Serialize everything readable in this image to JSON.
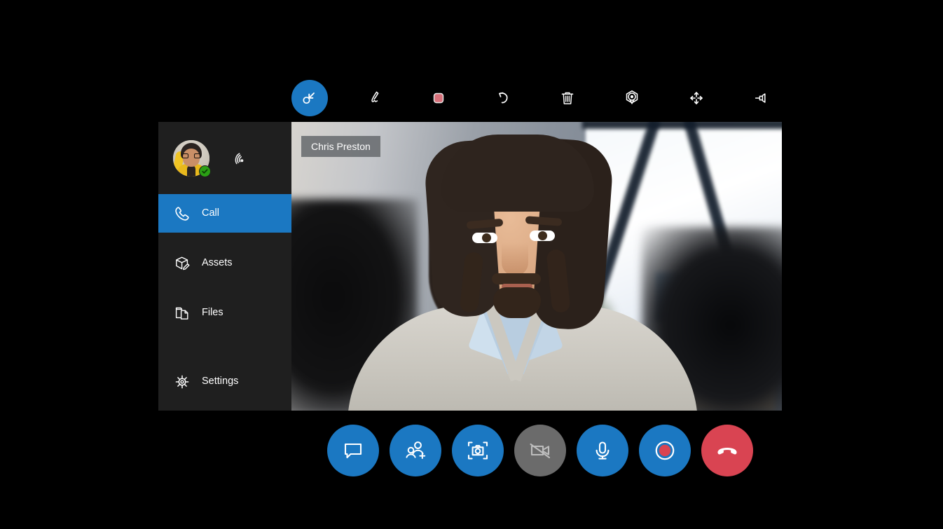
{
  "app": {
    "background_color": "#000000",
    "accent_color": "#1b78c2",
    "sidebar_color": "#1f1f1f",
    "danger_color": "#d94452",
    "online_color": "#2aa014"
  },
  "toolbar": {
    "items": [
      {
        "name": "select-tool",
        "label": "Select",
        "icon": "cursor-select-icon",
        "active": true
      },
      {
        "name": "ink-tool",
        "label": "Ink",
        "icon": "pen-icon",
        "active": false
      },
      {
        "name": "color-swatch",
        "label": "Color",
        "icon": "color-swatch-icon",
        "active": false,
        "color": "#d7707a"
      },
      {
        "name": "undo-tool",
        "label": "Undo",
        "icon": "undo-arrow-icon",
        "active": false
      },
      {
        "name": "delete-tool",
        "label": "Delete",
        "icon": "trash-icon",
        "active": false
      },
      {
        "name": "anchor-tool",
        "label": "Anchor",
        "icon": "location-anchor-icon",
        "active": false
      },
      {
        "name": "move-tool",
        "label": "Move",
        "icon": "move-arrows-icon",
        "active": false
      },
      {
        "name": "pin-tool",
        "label": "Pin",
        "icon": "pushpin-icon",
        "active": false
      }
    ]
  },
  "sidebar": {
    "user": {
      "avatar_alt": "User avatar",
      "presence": "available",
      "presence_icon": "check-badge-icon",
      "signal_icon": "signal-strength-icon"
    },
    "items": [
      {
        "label": "Call",
        "icon": "phone-icon",
        "active": true
      },
      {
        "label": "Assets",
        "icon": "assets-box-icon",
        "active": false
      },
      {
        "label": "Files",
        "icon": "files-folder-icon",
        "active": false
      },
      {
        "label": "Settings",
        "icon": "gear-icon",
        "active": false
      }
    ]
  },
  "video": {
    "participant_name": "Chris Preston"
  },
  "callbar": {
    "buttons": [
      {
        "name": "chat-button",
        "label": "Chat",
        "icon": "chat-bubble-icon",
        "style": "blue"
      },
      {
        "name": "add-participant-button",
        "label": "Add participant",
        "icon": "add-person-icon",
        "style": "blue"
      },
      {
        "name": "snapshot-button",
        "label": "Snapshot",
        "icon": "camera-capture-icon",
        "style": "blue"
      },
      {
        "name": "video-toggle-button",
        "label": "Video off",
        "icon": "video-off-icon",
        "style": "gray"
      },
      {
        "name": "mic-button",
        "label": "Microphone",
        "icon": "microphone-icon",
        "style": "blue"
      },
      {
        "name": "record-button",
        "label": "Record",
        "icon": "record-dot-icon",
        "style": "blue"
      },
      {
        "name": "hangup-button",
        "label": "End call",
        "icon": "hangup-phone-icon",
        "style": "red"
      }
    ]
  }
}
